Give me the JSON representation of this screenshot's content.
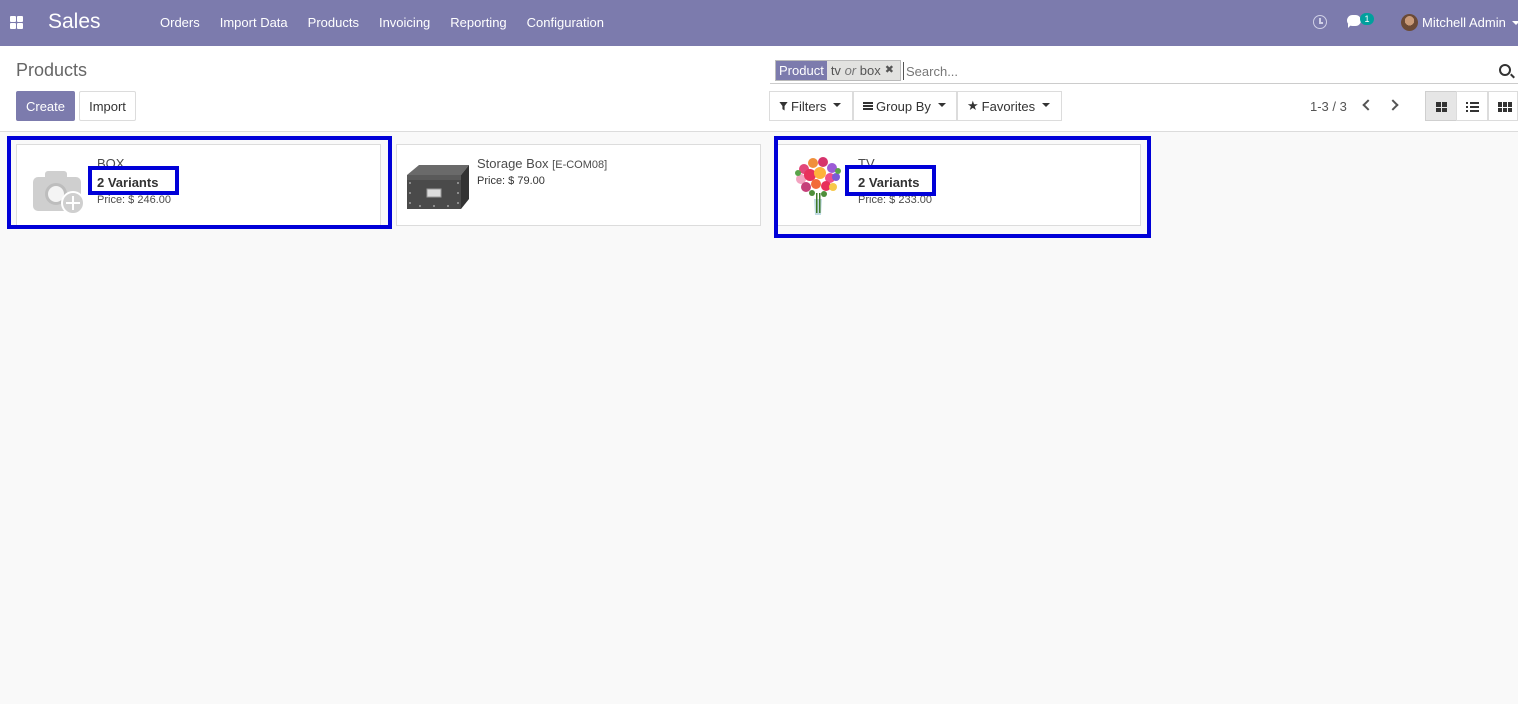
{
  "app": {
    "brand": "Sales",
    "menu": [
      "Orders",
      "Import Data",
      "Products",
      "Invoicing",
      "Reporting",
      "Configuration"
    ],
    "chat_count": "1",
    "user_name": "Mitchell Admin"
  },
  "control_panel": {
    "title": "Products",
    "create_label": "Create",
    "import_label": "Import",
    "search": {
      "facet_label": "Product",
      "facet_value_1": "tv",
      "facet_separator": "or",
      "facet_value_2": "box",
      "placeholder": "Search..."
    },
    "filters_label": "Filters",
    "groupby_label": "Group By",
    "favorites_label": "Favorites",
    "pager": "1-3 / 3"
  },
  "products": [
    {
      "name": "BOX",
      "ref": "",
      "variants": "2 Variants",
      "price": "Price: $ 246.00",
      "image": "placeholder-camera"
    },
    {
      "name": "Storage Box",
      "ref": "[E-COM08]",
      "variants": "",
      "price": "Price: $ 79.00",
      "image": "storage-box"
    },
    {
      "name": "TV",
      "ref": "",
      "variants": "2 Variants",
      "price": "Price: $ 233.00",
      "image": "flower-bouquet"
    }
  ],
  "colors": {
    "brand": "#7c7bad",
    "highlight": "#0000d8",
    "badge": "#00a09d"
  }
}
